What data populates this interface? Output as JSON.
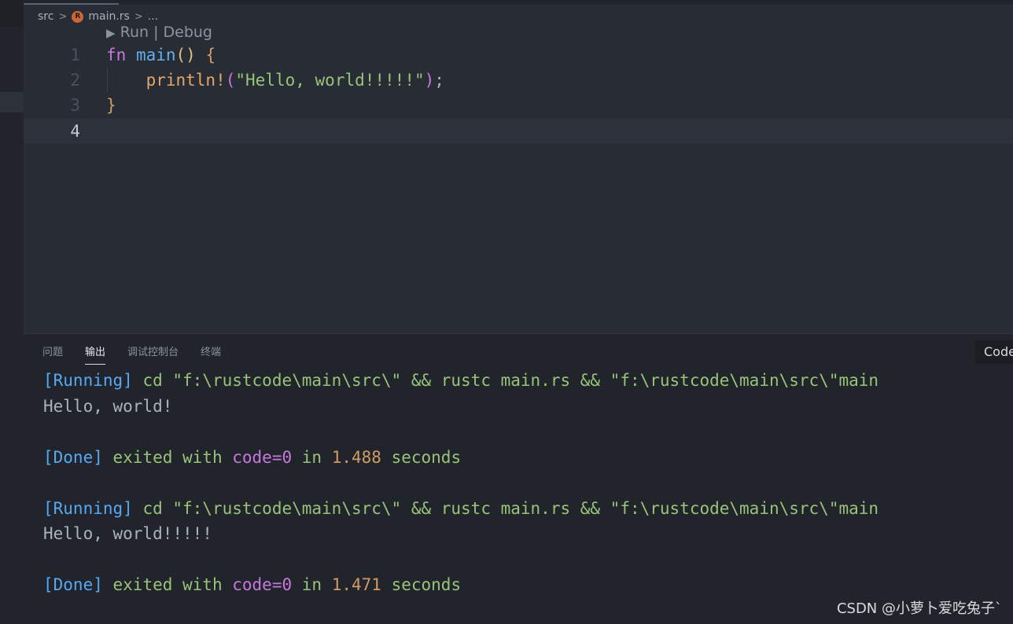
{
  "breadcrumb": {
    "folder": "src",
    "file": "main.rs",
    "more": "...",
    "file_icon": "R"
  },
  "editor": {
    "codelens": "Run | Debug",
    "lines": [
      {
        "number": "1",
        "t1": "fn",
        "t2": "main",
        "t3": "()",
        "t4": "{"
      },
      {
        "number": "2",
        "macro": "println!",
        "open": "(",
        "string": "\"Hello, world!!!!!\"",
        "close": ")",
        "end": ";"
      },
      {
        "number": "3",
        "brace": "}"
      },
      {
        "number": "4"
      }
    ]
  },
  "panel": {
    "tabs": [
      "问题",
      "输出",
      "调试控制台",
      "终端"
    ],
    "active_tab": "输出",
    "output_channel": "Code",
    "runs": [
      {
        "running_tag": "[Running]",
        "command": "cd \"f:\\rustcode\\main\\src\\\" && rustc main.rs && \"f:\\rustcode\\main\\src\\\"main",
        "program_output": "Hello, world!",
        "done_tag": "[Done]",
        "exited": "exited with",
        "code": "code=0",
        "in": "in",
        "duration": "1.488",
        "seconds": "seconds"
      },
      {
        "running_tag": "[Running]",
        "command": "cd \"f:\\rustcode\\main\\src\\\" && rustc main.rs && \"f:\\rustcode\\main\\src\\\"main",
        "program_output": "Hello, world!!!!!",
        "done_tag": "[Done]",
        "exited": "exited with",
        "code": "code=0",
        "in": "in",
        "duration": "1.471",
        "seconds": "seconds"
      }
    ]
  },
  "watermark": "CSDN @小萝卜爱吃兔子`",
  "colors": {
    "background": "#282c34",
    "panel": "#21252b",
    "accent_blue": "#56a8f5",
    "string_green": "#98c379"
  }
}
